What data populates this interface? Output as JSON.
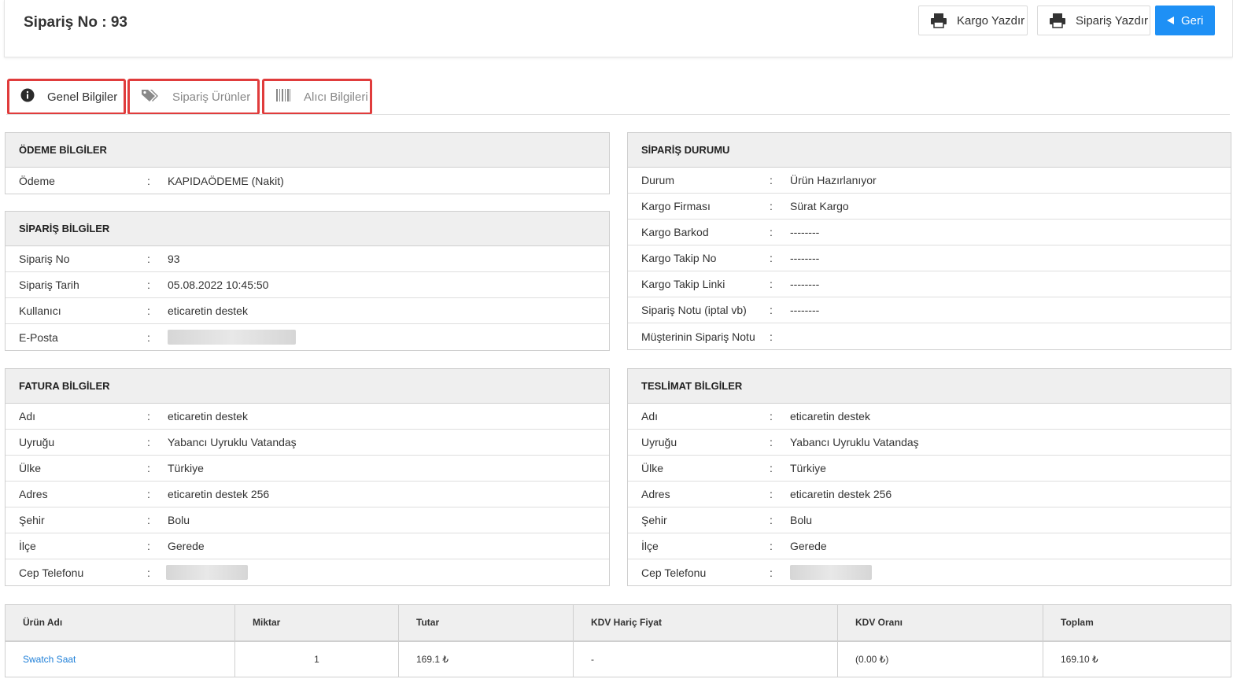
{
  "header": {
    "title": "Sipariş No : 93",
    "kargo_label": "Kargo Yazdır",
    "siparis_label": "Sipariş Yazdır",
    "geri_label": "Geri"
  },
  "tabs": [
    {
      "label": "Genel Bilgiler",
      "icon": "info-circle-icon"
    },
    {
      "label": "Sipariş Ürünler",
      "icon": "tags-icon"
    },
    {
      "label": "Alıcı Bilgileri",
      "icon": "barcode-icon"
    }
  ],
  "odeme": {
    "title": "ÖDEME BİLGİLER",
    "rows": [
      {
        "label": "Ödeme",
        "value": "KAPIDAÖDEME (Nakit)"
      }
    ]
  },
  "siparis_bilgiler": {
    "title": "SİPARİŞ BİLGİLER",
    "rows": [
      {
        "label": "Sipariş No",
        "value": "93"
      },
      {
        "label": "Sipariş Tarih",
        "value": "05.08.2022 10:45:50"
      },
      {
        "label": "Kullanıcı",
        "value": "eticaretin destek"
      },
      {
        "label": "E-Posta",
        "value": ""
      }
    ]
  },
  "siparis_durumu": {
    "title": "SİPARİŞ DURUMU",
    "rows": [
      {
        "label": "Durum",
        "value": "Ürün Hazırlanıyor"
      },
      {
        "label": "Kargo Firması",
        "value": "Sürat Kargo"
      },
      {
        "label": "Kargo Barkod",
        "value": "--------"
      },
      {
        "label": "Kargo Takip No",
        "value": "--------"
      },
      {
        "label": "Kargo Takip Linki",
        "value": "--------"
      },
      {
        "label": "Sipariş Notu (iptal vb)",
        "value": "--------"
      },
      {
        "label": "Müşterinin Sipariş Notu",
        "value": ""
      }
    ]
  },
  "fatura": {
    "title": "FATURA BİLGİLER",
    "rows": [
      {
        "label": "Adı",
        "value": "eticaretin destek"
      },
      {
        "label": "Uyruğu",
        "value": "Yabancı Uyruklu Vatandaş"
      },
      {
        "label": "Ülke",
        "value": "Türkiye"
      },
      {
        "label": "Adres",
        "value": "eticaretin destek 256"
      },
      {
        "label": "Şehir",
        "value": "Bolu"
      },
      {
        "label": "İlçe",
        "value": "Gerede"
      },
      {
        "label": "Cep Telefonu",
        "value": ""
      }
    ]
  },
  "teslimat": {
    "title": "TESLİMAT BİLGİLER",
    "rows": [
      {
        "label": "Adı",
        "value": "eticaretin destek"
      },
      {
        "label": "Uyruğu",
        "value": "Yabancı Uyruklu Vatandaş"
      },
      {
        "label": "Ülke",
        "value": "Türkiye"
      },
      {
        "label": "Adres",
        "value": "eticaretin destek 256"
      },
      {
        "label": "Şehir",
        "value": "Bolu"
      },
      {
        "label": "İlçe",
        "value": "Gerede"
      },
      {
        "label": "Cep Telefonu",
        "value": ""
      }
    ]
  },
  "separator": ":",
  "products": {
    "columns": [
      "Ürün Adı",
      "Miktar",
      "Tutar",
      "KDV Hariç Fiyat",
      "KDV Oranı",
      "Toplam"
    ],
    "rows": [
      {
        "name": "Swatch Saat",
        "qty": "1",
        "amount": "169.1 ₺",
        "net": "-",
        "vat": "(0.00 ₺)",
        "total": "169.10 ₺"
      }
    ]
  },
  "colors": {
    "accent": "#1e90f5",
    "tab_highlight": "#e03c3c",
    "link": "#1e7fd8"
  }
}
